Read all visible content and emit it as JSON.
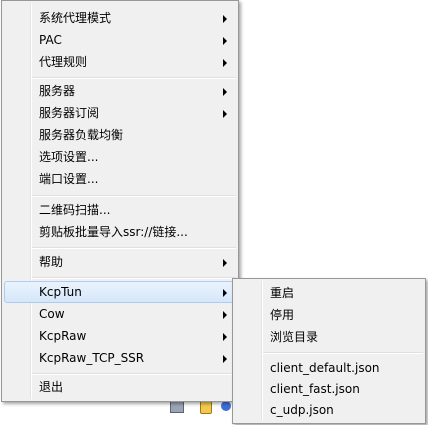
{
  "main_menu": {
    "items": [
      {
        "label": "系统代理模式",
        "submenu": true
      },
      {
        "label": "PAC",
        "submenu": true
      },
      {
        "label": "代理规则",
        "submenu": true
      },
      {
        "label": "服务器",
        "submenu": true
      },
      {
        "label": "服务器订阅",
        "submenu": true
      },
      {
        "label": "服务器负载均衡",
        "submenu": false
      },
      {
        "label": "选项设置...",
        "submenu": false
      },
      {
        "label": "端口设置...",
        "submenu": false
      },
      {
        "label": "二维码扫描...",
        "submenu": false
      },
      {
        "label": "剪贴板批量导入ssr://链接...",
        "submenu": false
      },
      {
        "label": "帮助",
        "submenu": true
      },
      {
        "label": "KcpTun",
        "submenu": true,
        "highlighted": true
      },
      {
        "label": "Cow",
        "submenu": true
      },
      {
        "label": "KcpRaw",
        "submenu": true
      },
      {
        "label": "KcpRaw_TCP_SSR",
        "submenu": true
      },
      {
        "label": "退出",
        "submenu": false
      }
    ]
  },
  "kcptun_submenu": {
    "items": [
      {
        "label": "重启"
      },
      {
        "label": "停用"
      },
      {
        "label": "浏览目录"
      },
      {
        "label": "client_default.json"
      },
      {
        "label": "client_fast.json"
      },
      {
        "label": "c_udp.json"
      }
    ]
  },
  "colors": {
    "menu_background": "#f0f0f0",
    "menu_border": "#979797",
    "highlight_border": "#aeccf0"
  }
}
